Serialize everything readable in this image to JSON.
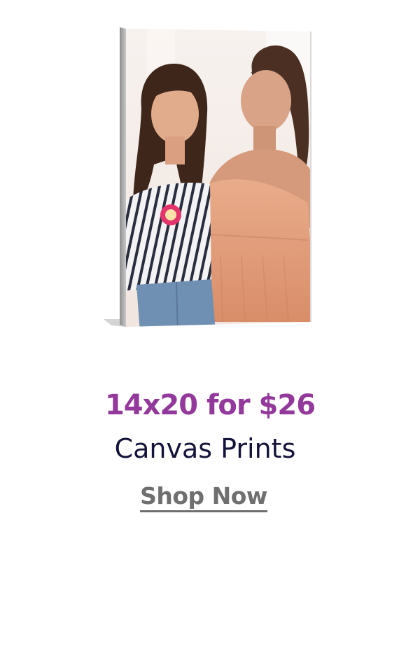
{
  "promo": {
    "image_alt": "14x20 canvas print of two smiling women",
    "headline": "14x20 for $26",
    "product": "Canvas Prints",
    "cta_label": "Shop Now"
  },
  "colors": {
    "headline": "#93399b",
    "product": "#14143a",
    "cta": "#6f6f6f",
    "background": "#ffffff"
  }
}
